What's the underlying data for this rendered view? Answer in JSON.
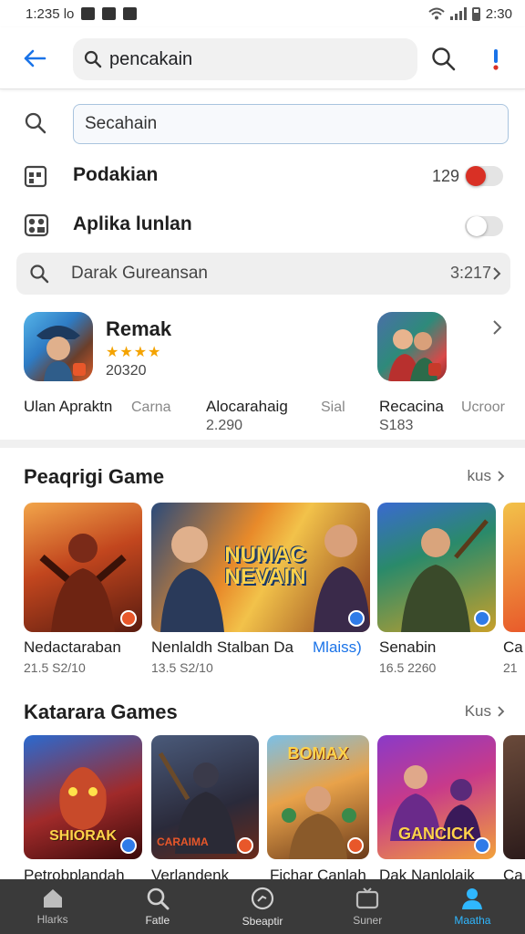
{
  "status": {
    "time": "1:235 lo",
    "right_time": "2:30"
  },
  "header": {
    "query": "pencakain"
  },
  "suggestions": {
    "field_value": "Secahain",
    "row1": {
      "label": "Podakian",
      "count": "129"
    },
    "row2": {
      "label": "Aplika lunlan"
    },
    "pill": {
      "text": "Darak Gureansan",
      "value": "3:217"
    }
  },
  "featured": {
    "name": "Remak",
    "stars": "★★★★",
    "count": "20320",
    "labels": [
      {
        "title": "Ulan Apraktn",
        "meta": ""
      },
      {
        "title": "Carna",
        "meta": ""
      },
      {
        "title": "Alocarahaig",
        "meta": "2.290"
      },
      {
        "title": "Sial",
        "meta": ""
      },
      {
        "title": "Recacina",
        "meta": "S183"
      },
      {
        "title": "Ucroor",
        "meta": ""
      }
    ]
  },
  "section1": {
    "title": "Peaqrigi Game",
    "more": "kus",
    "cards": [
      {
        "name": "Nedactaraban",
        "meta": "21.5 S2/10",
        "banner": ""
      },
      {
        "name": "Nenlaldh Stalban Da",
        "name_link": "Mlaiss)",
        "meta": "13.5 S2/10",
        "banner": "NUMAC NEVAIN"
      },
      {
        "name": "Senabin",
        "meta": "16.5 2260",
        "banner": ""
      },
      {
        "name": "Ca",
        "meta": "21",
        "banner": ""
      }
    ]
  },
  "section2": {
    "title": "Katarara Games",
    "more": "Kus",
    "cards": [
      {
        "name": "Petrobplandah",
        "banner": "SHIORAK"
      },
      {
        "name": "Verlandenk",
        "banner": "CARAIMA"
      },
      {
        "name": "Fichar Canlah",
        "banner": "BOMAX"
      },
      {
        "name": "Dak Nanlolaik",
        "banner": "GANCICK"
      },
      {
        "name": "Ca",
        "banner": ""
      }
    ]
  },
  "nav": [
    {
      "label": "Hlarks",
      "icon": "home-icon"
    },
    {
      "label": "Fatle",
      "icon": "search-icon"
    },
    {
      "label": "Sbeaptir",
      "icon": "compass-icon"
    },
    {
      "label": "Suner",
      "icon": "tv-icon"
    },
    {
      "label": "Maatha",
      "icon": "person-icon",
      "active": true
    }
  ],
  "colors": {
    "accent": "#1a73e8",
    "nav_active": "#2fb7ff",
    "nav_bg": "#3a3a3a"
  }
}
